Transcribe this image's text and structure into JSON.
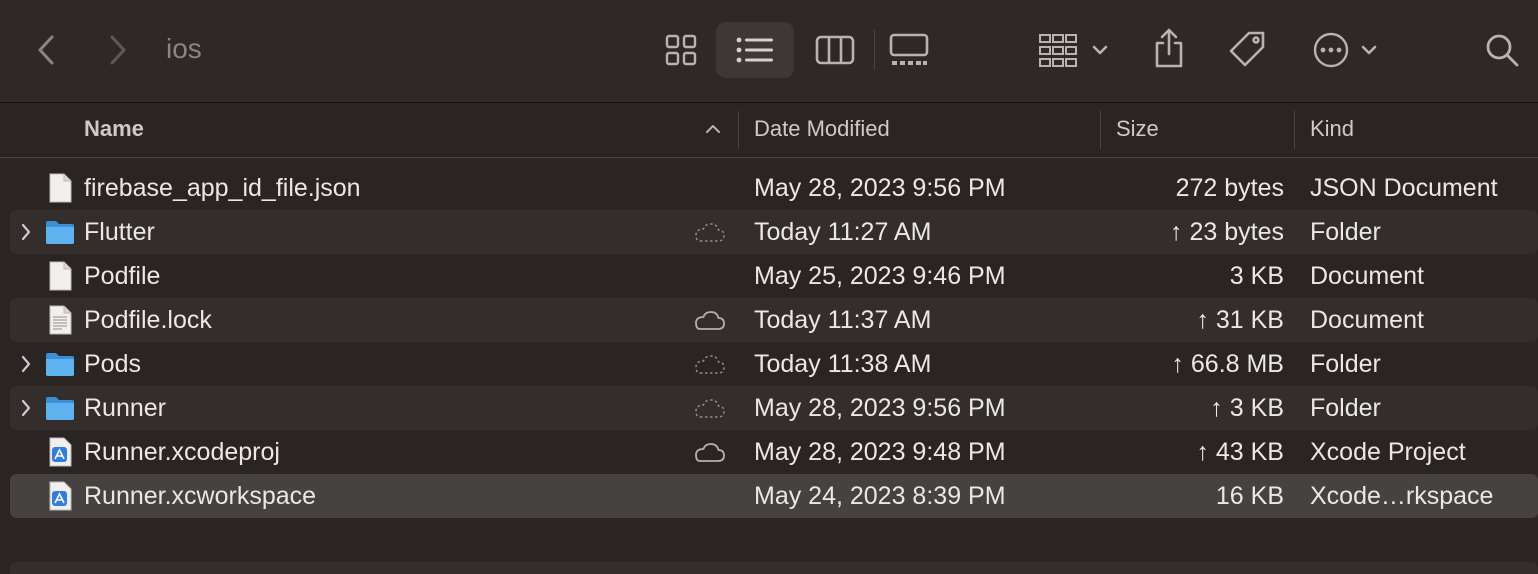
{
  "window": {
    "title": "ios"
  },
  "toolbar": {
    "icons": [
      "back-icon",
      "forward-icon",
      "icon-view-icon",
      "list-view-icon",
      "column-view-icon",
      "gallery-view-icon",
      "group-icon",
      "share-icon",
      "tag-icon",
      "more-icon",
      "search-icon"
    ],
    "active_view": "list-view"
  },
  "columns": {
    "name": "Name",
    "date": "Date Modified",
    "size": "Size",
    "kind": "Kind",
    "sort_indicator": "^"
  },
  "files": [
    {
      "name": "firebase_app_id_file.json",
      "date": "May 28, 2023 9:56 PM",
      "size": "272 bytes",
      "kind": "JSON Document",
      "type": "document",
      "expandable": false,
      "cloud": "none"
    },
    {
      "name": "Flutter",
      "date": "Today 11:27 AM",
      "size": "↑ 23 bytes",
      "kind": "Folder",
      "type": "folder",
      "expandable": true,
      "cloud": "dashed"
    },
    {
      "name": "Podfile",
      "date": "May 25, 2023 9:46 PM",
      "size": "3 KB",
      "kind": "Document",
      "type": "document",
      "expandable": false,
      "cloud": "none"
    },
    {
      "name": "Podfile.lock",
      "date": "Today 11:37 AM",
      "size": "↑ 31 KB",
      "kind": "Document",
      "type": "text-document",
      "expandable": false,
      "cloud": "solid"
    },
    {
      "name": "Pods",
      "date": "Today 11:38 AM",
      "size": "↑ 66.8 MB",
      "kind": "Folder",
      "type": "folder",
      "expandable": true,
      "cloud": "dashed"
    },
    {
      "name": "Runner",
      "date": "May 28, 2023 9:56 PM",
      "size": "↑ 3 KB",
      "kind": "Folder",
      "type": "folder",
      "expandable": true,
      "cloud": "dashed"
    },
    {
      "name": "Runner.xcodeproj",
      "date": "May 28, 2023 9:48 PM",
      "size": "↑ 43 KB",
      "kind": "Xcode Project",
      "type": "xcode",
      "expandable": false,
      "cloud": "solid"
    },
    {
      "name": "Runner.xcworkspace",
      "date": "May 24, 2023 8:39 PM",
      "size": "16 KB",
      "kind": "Xcode…rkspace",
      "type": "xcode",
      "expandable": false,
      "cloud": "none",
      "selected": true
    }
  ],
  "colors": {
    "background": "#2a2522",
    "selected_row": "#46423f",
    "alt_row": "#332e2b",
    "folder": "#4aa3e8"
  }
}
